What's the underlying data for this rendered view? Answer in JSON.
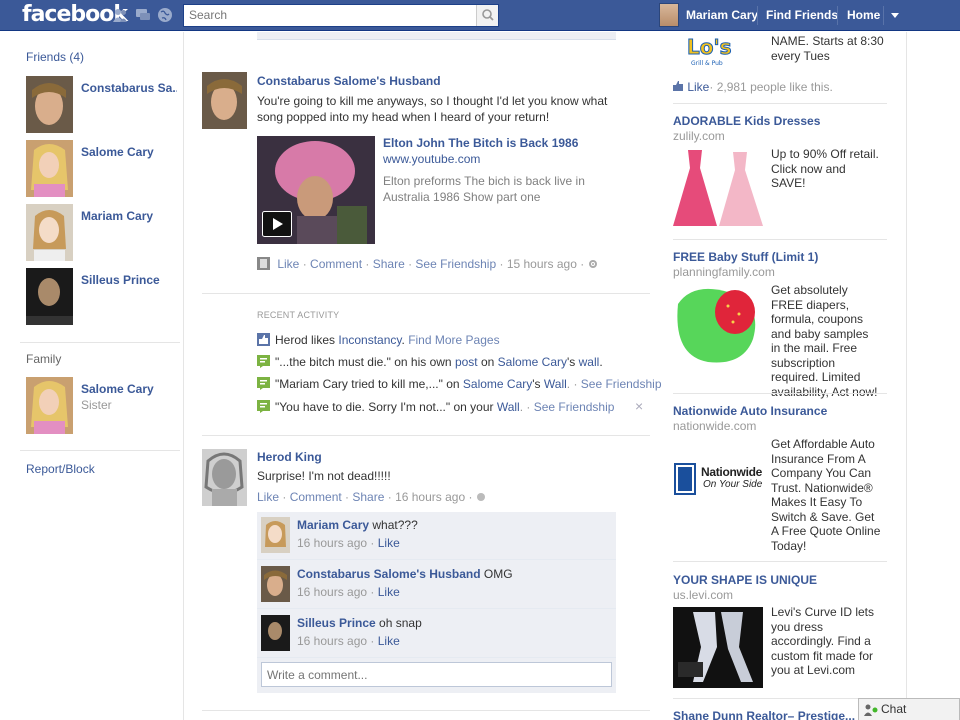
{
  "header": {
    "logo": "facebook",
    "search_placeholder": "Search",
    "profile_name": "Mariam Cary",
    "nav": [
      "Find Friends",
      "Home"
    ]
  },
  "left": {
    "friends_title": "Friends",
    "friends_count": "(4)",
    "friends": [
      {
        "name": "Constabarus Sa..."
      },
      {
        "name": "Salome Cary"
      },
      {
        "name": "Mariam Cary"
      },
      {
        "name": "Silleus Prince"
      }
    ],
    "family_title": "Family",
    "family": [
      {
        "name": "Salome Cary",
        "relation": "Sister"
      }
    ],
    "report_block": "Report/Block"
  },
  "feed": {
    "story1": {
      "author": "Constabarus Salome's Husband",
      "text": "You're going to kill me anyways, so I thought I'd let you know what song popped into my head when I heard of your return!",
      "link_title": "Elton John The Bitch is Back 1986",
      "link_url": "www.youtube.com",
      "link_desc": "Elton preforms The bich is back live in Australia 1986 Show part one",
      "actions": [
        "Like",
        "Comment",
        "Share",
        "See Friendship"
      ],
      "time": "15 hours ago"
    },
    "recent_activity": {
      "title": "RECENT ACTIVITY",
      "line1": {
        "pre": "Herod likes ",
        "link": "Inconstancy",
        "post": ". ",
        "more": "Find More Pages"
      },
      "line2": {
        "quote": "\"...the bitch must die.\" on his own ",
        "link1": "post",
        "mid": " on ",
        "link2": "Salome Cary",
        "mid2": "'s ",
        "link3": "wall",
        "end": "."
      },
      "line3": {
        "quote": "\"Mariam Cary tried to kill me,...\" on ",
        "link1": "Salome Cary",
        "mid": "'s ",
        "link2": "Wall",
        "end": ". · ",
        "friendship": "See Friendship"
      },
      "line4": {
        "quote": "\"You have to die. Sorry I'm not...\" on your ",
        "link1": "Wall",
        "end": ". · ",
        "friendship": "See Friendship"
      },
      "close": "×"
    },
    "story2": {
      "author": "Herod King",
      "text": "Surprise! I'm not dead!!!!!",
      "actions": [
        "Like",
        "Comment",
        "Share"
      ],
      "time": "16 hours ago",
      "comments": [
        {
          "name": "Mariam Cary",
          "text": "what???",
          "time": "16 hours ago",
          "like": "Like"
        },
        {
          "name": "Constabarus Salome's Husband",
          "text": "OMG",
          "time": "16 hours ago",
          "like": "Like"
        },
        {
          "name": "Silleus Prince",
          "text": "oh snap",
          "time": "16 hours ago",
          "like": "Like"
        }
      ],
      "write_placeholder": "Write a comment..."
    }
  },
  "ads": {
    "top_partial": {
      "body_line1": "NAME. Starts at 8:30",
      "body_line2": "every Tues",
      "like": "Like",
      "like_count": "2,981 people like this."
    },
    "items": [
      {
        "title": "ADORABLE Kids Dresses",
        "url": "zulily.com",
        "body": "Up to 90% Off retail. Click now and SAVE!"
      },
      {
        "title": "FREE Baby Stuff (Limit 1)",
        "url": "planningfamily.com",
        "body": "Get absolutely FREE diapers, formula, coupons and baby samples in the mail. Free subscription required. Limited availability, Act now!"
      },
      {
        "title": "Nationwide Auto Insurance",
        "url": "nationwide.com",
        "body": "Get Affordable Auto Insurance From A Company You Can Trust. Nationwide® Makes It Easy To Switch & Save. Get A Free Quote Online Today!",
        "logo": "Nationwide",
        "logo_tag": "On Your Side"
      },
      {
        "title": "YOUR SHAPE IS UNIQUE",
        "url": "us.levi.com",
        "body": "Levi's Curve ID lets you dress accordingly. Find a custom fit made for you at Levi.com"
      },
      {
        "title": "Shane Dunn Realtor– Prestige..."
      }
    ]
  },
  "chat": {
    "label": "Chat"
  }
}
